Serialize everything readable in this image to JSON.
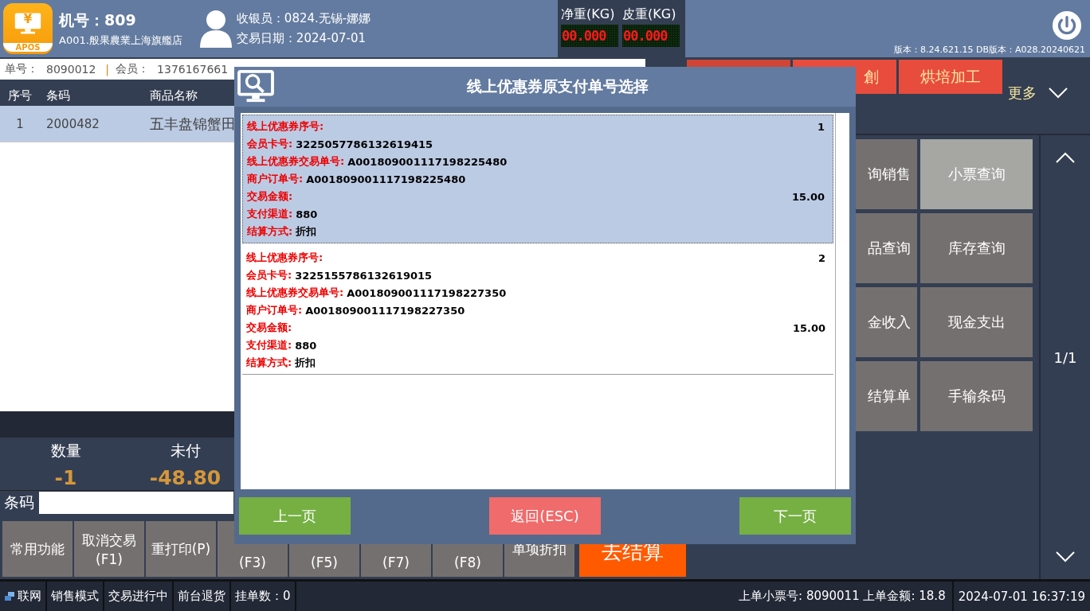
{
  "header": {
    "logo_glyph": "¥",
    "logo_text": "APOS",
    "machine": "机号：809",
    "store": "A001.般果農業上海旗艦店",
    "cashier": "收银员：0824.无锡-娜娜",
    "date": "交易日期：2024-07-01"
  },
  "scales": [
    {
      "label": "净重(KG)",
      "reading": "00.000"
    },
    {
      "label": "皮重(KG)",
      "reading": "00.000"
    }
  ],
  "version": "版本：8.24.621.15 DB版本：A028.20240621",
  "order_info": {
    "order_label": "单号：",
    "order_no": "8090012",
    "separator": "|",
    "member_label": "会员：",
    "member": "1376167661"
  },
  "table": {
    "columns": [
      "序号",
      "条码",
      "商品名称"
    ],
    "rows": [
      {
        "cells": [
          "1",
          "2000482",
          "五丰盘锦蟹田"
        ],
        "selected": true
      }
    ]
  },
  "totals": [
    {
      "label": "数量",
      "value": "-1"
    },
    {
      "label": "未付",
      "value": "-48.80"
    }
  ],
  "barcode": {
    "label": "条码"
  },
  "function_buttons": [
    {
      "lines": [
        "常用功能"
      ]
    },
    {
      "lines": [
        "取消交易",
        "(F1)"
      ]
    },
    {
      "lines": [
        "重打印(P)"
      ]
    },
    {
      "lines": [
        "(F3)"
      ]
    },
    {
      "lines": [
        "(F5)"
      ]
    },
    {
      "lines": [
        "(F7)"
      ]
    },
    {
      "lines": [
        "(F8)"
      ]
    },
    {
      "lines": [
        "单项折扣"
      ]
    }
  ],
  "checkout": "去结算",
  "top_buttons": [
    "創",
    "烘培加工"
  ],
  "more": "更多",
  "grid_buttons": [
    {
      "label": "询销售",
      "selected": false
    },
    {
      "label": "小票查询",
      "selected": true
    },
    {
      "label": "品查询",
      "selected": false
    },
    {
      "label": "库存查询",
      "selected": false
    },
    {
      "label": "金收入",
      "selected": false
    },
    {
      "label": "现金支出",
      "selected": false
    },
    {
      "label": "结算单",
      "selected": false
    },
    {
      "label": "手输条码",
      "selected": false
    }
  ],
  "pager": "1/1",
  "status_bar": {
    "items": [
      "联网",
      "销售模式",
      "交易进行中",
      "前台退货",
      "挂单数：0"
    ],
    "last_receipt": "上单小票号: 8090011 上单金额: 18.8",
    "datetime": "2024-07-01 16:37:19"
  },
  "dialog": {
    "title": "线上优惠券原支付单号选择",
    "coupons": [
      {
        "selected": true,
        "fields": [
          {
            "kind": "right",
            "label": "线上优惠券序号:",
            "value": "1"
          },
          {
            "kind": "inline",
            "label": "会员卡号:",
            "value": "3225057786132619415"
          },
          {
            "kind": "inline",
            "label": "线上优惠券交易单号:",
            "value": "A001809001117198225480"
          },
          {
            "kind": "inline",
            "label": "商户订单号:",
            "value": "A001809001117198225480"
          },
          {
            "kind": "right",
            "label": "交易金额:",
            "value": "15.00"
          },
          {
            "kind": "inline",
            "label": "支付渠道:",
            "value": "880"
          },
          {
            "kind": "inline",
            "label": "结算方式:",
            "value": "折扣"
          }
        ]
      },
      {
        "selected": false,
        "fields": [
          {
            "kind": "right",
            "label": "线上优惠券序号:",
            "value": "2"
          },
          {
            "kind": "inline",
            "label": "会员卡号:",
            "value": "3225155786132619015"
          },
          {
            "kind": "inline",
            "label": "线上优惠券交易单号:",
            "value": "A001809001117198227350"
          },
          {
            "kind": "inline",
            "label": "商户订单号:",
            "value": "A001809001117198227350"
          },
          {
            "kind": "right",
            "label": "交易金额:",
            "value": "15.00"
          },
          {
            "kind": "inline",
            "label": "支付渠道:",
            "value": "880"
          },
          {
            "kind": "inline",
            "label": "结算方式:",
            "value": "折扣"
          }
        ]
      }
    ],
    "buttons": [
      {
        "label": "上一页",
        "kind": "nav"
      },
      {
        "label": "返回(ESC)",
        "kind": "cancel"
      },
      {
        "label": "下一页",
        "kind": "nav"
      }
    ]
  }
}
